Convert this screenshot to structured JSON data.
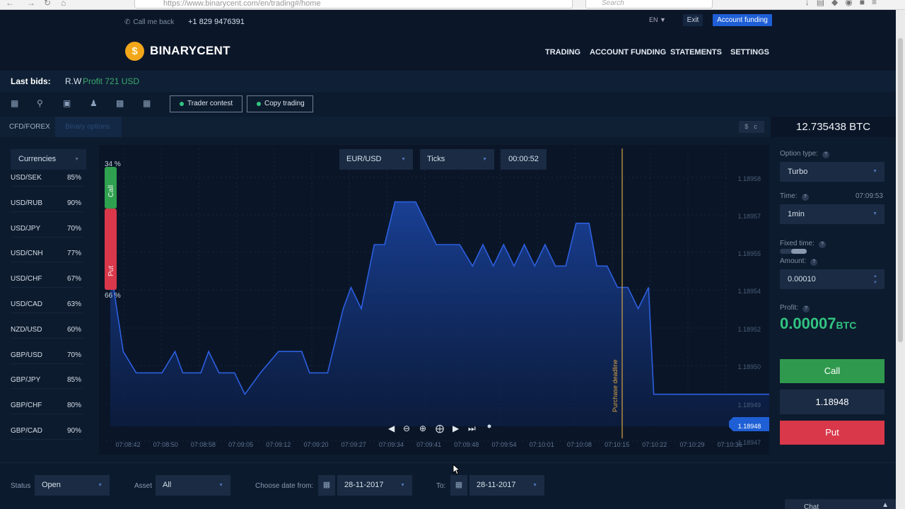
{
  "browser": {
    "url": "https://www.binarycent.com/en/trading#/home",
    "search_placeholder": "Search"
  },
  "header": {
    "call_me_back": "Call me back",
    "phone": "+1 829 9476391",
    "lang": "EN",
    "exit": "Exit",
    "account_funding_button": "Account funding",
    "logo_text": "BINARYCENT",
    "nav": [
      "TRADING",
      "ACCOUNT FUNDING",
      "STATEMENTS",
      "SETTINGS"
    ]
  },
  "last_bids": {
    "label": "Last bids:",
    "user": "R.W",
    "profit": "Profit 721 USD"
  },
  "toolbar": {
    "trader_contest": "Trader contest",
    "copy_trading": "Copy trading"
  },
  "tabs": {
    "cfd": "CFD/FOREX",
    "binary": "Binary options"
  },
  "currency_toggle": [
    "$",
    "c"
  ],
  "balance": "12.735438 BTC",
  "left_list": {
    "selector": "Currencies",
    "pairs": [
      {
        "name": "USD/SEK",
        "pct": "85%"
      },
      {
        "name": "USD/RUB",
        "pct": "90%"
      },
      {
        "name": "USD/JPY",
        "pct": "70%"
      },
      {
        "name": "USD/CNH",
        "pct": "77%"
      },
      {
        "name": "USD/CHF",
        "pct": "67%"
      },
      {
        "name": "USD/CAD",
        "pct": "63%"
      },
      {
        "name": "NZD/USD",
        "pct": "60%"
      },
      {
        "name": "GBP/USD",
        "pct": "70%"
      },
      {
        "name": "GBP/JPY",
        "pct": "85%"
      },
      {
        "name": "GBP/CHF",
        "pct": "80%"
      },
      {
        "name": "GBP/CAD",
        "pct": "90%"
      }
    ]
  },
  "chart_controls": {
    "asset": "EUR/USD",
    "mode": "Ticks",
    "timer": "00:00:52"
  },
  "sentiment": {
    "call_pct": "34 %",
    "put_pct": "66 %",
    "call_label": "Call",
    "put_label": "Put",
    "call_fraction": 0.34
  },
  "chart_data": {
    "type": "area",
    "title": "",
    "xlabel": "",
    "ylabel": "",
    "x": [
      "07:08:42",
      "07:08:50",
      "07:08:58",
      "07:09:05",
      "07:09:12",
      "07:09:20",
      "07:09:27",
      "07:09:34",
      "07:09:41",
      "07:09:48",
      "07:09:54",
      "07:10:01",
      "07:10:08",
      "07:10:15",
      "07:10:22",
      "07:10:29",
      "07:10:36"
    ],
    "y_ticks": [
      "1.18958",
      "1.18957",
      "1.18955",
      "1.18954",
      "1.18952",
      "1.18950",
      "1.18949",
      "1.18947"
    ],
    "series": [
      {
        "values": [
          [
            0,
            1.18954
          ],
          [
            0.5,
            1.1895
          ],
          [
            1,
            1.18949
          ],
          [
            1.5,
            1.18949
          ],
          [
            2,
            1.18949
          ],
          [
            2.5,
            1.1895
          ],
          [
            2.8,
            1.18949
          ],
          [
            3.5,
            1.18949
          ],
          [
            3.8,
            1.1895
          ],
          [
            4.2,
            1.18949
          ],
          [
            4.8,
            1.18949
          ],
          [
            5.2,
            1.18948
          ],
          [
            5.8,
            1.18949
          ],
          [
            6.5,
            1.1895
          ],
          [
            7.4,
            1.1895
          ],
          [
            7.7,
            1.18949
          ],
          [
            8.4,
            1.18949
          ],
          [
            9.0,
            1.18952
          ],
          [
            9.3,
            1.18953
          ],
          [
            9.7,
            1.18952
          ],
          [
            10.2,
            1.18955
          ],
          [
            10.6,
            1.18955
          ],
          [
            11.0,
            1.18957
          ],
          [
            11.8,
            1.18957
          ],
          [
            12.2,
            1.18956
          ],
          [
            12.6,
            1.18955
          ],
          [
            13.5,
            1.18955
          ],
          [
            14.0,
            1.18954
          ],
          [
            14.4,
            1.18955
          ],
          [
            14.8,
            1.18954
          ],
          [
            15.2,
            1.18955
          ],
          [
            15.6,
            1.18954
          ],
          [
            16.0,
            1.18955
          ],
          [
            16.4,
            1.18954
          ],
          [
            16.8,
            1.18955
          ],
          [
            17.2,
            1.18954
          ],
          [
            17.6,
            1.18954
          ],
          [
            18.0,
            1.18956
          ],
          [
            18.5,
            1.18956
          ],
          [
            18.8,
            1.18954
          ],
          [
            19.2,
            1.18954
          ],
          [
            19.6,
            1.18953
          ],
          [
            20.0,
            1.18953
          ],
          [
            20.4,
            1.18952
          ],
          [
            20.8,
            1.18953
          ],
          [
            21.0,
            1.18948
          ],
          [
            24.0,
            1.18948
          ],
          [
            29.0,
            1.18948
          ]
        ]
      }
    ],
    "current_price": "1.18948",
    "purchase_deadline_label": "Purchase deadline",
    "ylim": [
      1.189465,
      1.189595
    ]
  },
  "right_panel": {
    "option_type_label": "Option type:",
    "option_type": "Turbo",
    "time_label": "Time:",
    "time_value": "07:09:53",
    "duration": "1min",
    "fixed_time_label": "Fixed time:",
    "amount_label": "Amount:",
    "amount": "0.00010",
    "profit_label": "Profit:",
    "profit_value": "0.00007",
    "profit_unit": "BTC",
    "call": "Call",
    "price": "1.18948",
    "put": "Put"
  },
  "bottom": {
    "status_label": "Status",
    "status": "Open",
    "asset_label": "Asset",
    "asset": "All",
    "date_from_label": "Choose date from:",
    "date_from": "28-11-2017",
    "to_label": "To:",
    "date_to": "28-11-2017",
    "chat": "Chat"
  },
  "colors": {
    "accent": "#1f5fd6",
    "call": "#2f9a4d",
    "put": "#d8384a",
    "profit": "#31c481",
    "deadline": "#d9a441",
    "chart_line": "#2d5fe0"
  }
}
